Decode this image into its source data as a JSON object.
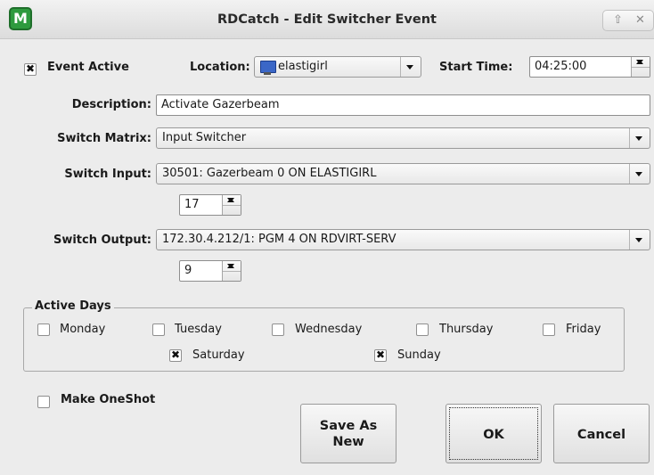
{
  "window": {
    "title": "RDCatch - Edit Switcher Event",
    "icon": "rdcatch-app-icon",
    "controls": [
      "minimize-icon",
      "close-icon"
    ]
  },
  "event_active": {
    "label": "Event Active",
    "checked": true
  },
  "location": {
    "label": "Location:",
    "value": "elastigirl",
    "icon": "monitor-icon"
  },
  "start_time": {
    "label": "Start Time:",
    "value": "04:25:00"
  },
  "description": {
    "label": "Description:",
    "value": "Activate Gazerbeam"
  },
  "switch_matrix": {
    "label": "Switch Matrix:",
    "value": "Input Switcher"
  },
  "switch_input": {
    "label": "Switch Input:",
    "value": "30501: Gazerbeam 0 ON ELASTIGIRL",
    "number": "17"
  },
  "switch_output": {
    "label": "Switch Output:",
    "value": "172.30.4.212/1: PGM 4 ON RDVIRT-SERV",
    "number": "9"
  },
  "active_days": {
    "title": "Active Days",
    "days": [
      {
        "label": "Monday",
        "checked": false
      },
      {
        "label": "Tuesday",
        "checked": false
      },
      {
        "label": "Wednesday",
        "checked": false
      },
      {
        "label": "Thursday",
        "checked": false
      },
      {
        "label": "Friday",
        "checked": false
      },
      {
        "label": "Saturday",
        "checked": true
      },
      {
        "label": "Sunday",
        "checked": true
      }
    ]
  },
  "make_oneshot": {
    "label": "Make OneShot",
    "checked": false
  },
  "buttons": {
    "save_as_new": "Save As\nNew",
    "ok": "OK",
    "cancel": "Cancel"
  },
  "colors": {
    "window_bg": "#ececec",
    "icon_green": "#2e9a3e"
  }
}
